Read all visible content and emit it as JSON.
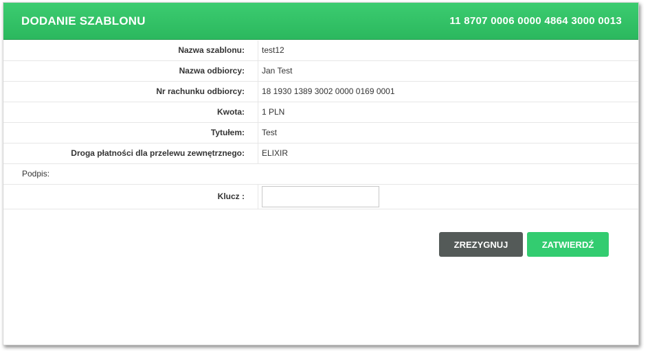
{
  "header": {
    "title": "DODANIE SZABLONU",
    "account_number": "11 8707 0006 0000 4864 3000 0013"
  },
  "fields": [
    {
      "label": "Nazwa szablonu:",
      "value": "test12"
    },
    {
      "label": "Nazwa odbiorcy:",
      "value": "Jan Test"
    },
    {
      "label": "Nr rachunku odbiorcy:",
      "value": "18 1930 1389 3002 0000 0169 0001"
    },
    {
      "label": "Kwota:",
      "value": "1 PLN"
    },
    {
      "label": "Tytułem:",
      "value": "Test"
    },
    {
      "label": "Droga płatności dla przelewu zewnętrznego:",
      "value": "ELIXIR"
    }
  ],
  "signature": {
    "section_label": "Podpis:",
    "key_label": "Klucz :",
    "key_value": ""
  },
  "buttons": {
    "cancel_label": "ZREZYGNUJ",
    "confirm_label": "ZATWIERDŹ"
  },
  "colors": {
    "header_green": "#2bb85e",
    "confirm_green": "#33cc70",
    "cancel_gray": "#545a58"
  }
}
